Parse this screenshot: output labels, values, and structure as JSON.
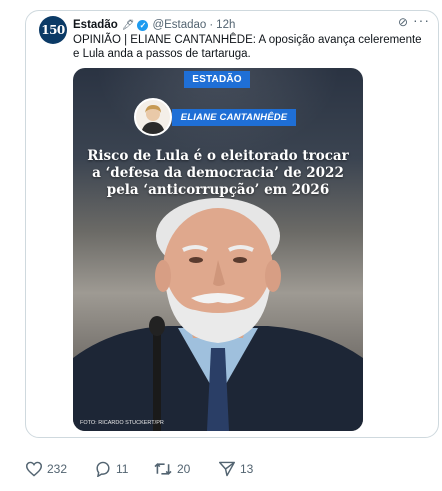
{
  "tweet": {
    "author_name": "Estadão",
    "author_pen": "🖋",
    "author_handle": "@Estadao",
    "separator": "·",
    "time": "12h",
    "avatar_text": "150",
    "text": "OPINIÃO | ELIANE CANTANHÊDE: A oposição avança celeremente e Lula anda a passos de tartaruga.",
    "more_icon": "more-icon",
    "grok_icon": "grok-icon"
  },
  "media": {
    "brand": "ESTADÃO",
    "author_label": "ELIANE CANTANHÊDE",
    "headline": "Risco de Lula é o eleitorado trocar a ‘defesa da democracia’ de 2022 pela ‘anticorrupção’ em 2026",
    "credit": "FOTO: RICARDO STUCKERT/PR"
  },
  "actions": {
    "likes": "232",
    "replies": "11",
    "reposts": "20",
    "shares": "13"
  },
  "colors": {
    "accent": "#1d9bf0",
    "brand_blue": "#1f6fd6",
    "muted": "#536471"
  }
}
